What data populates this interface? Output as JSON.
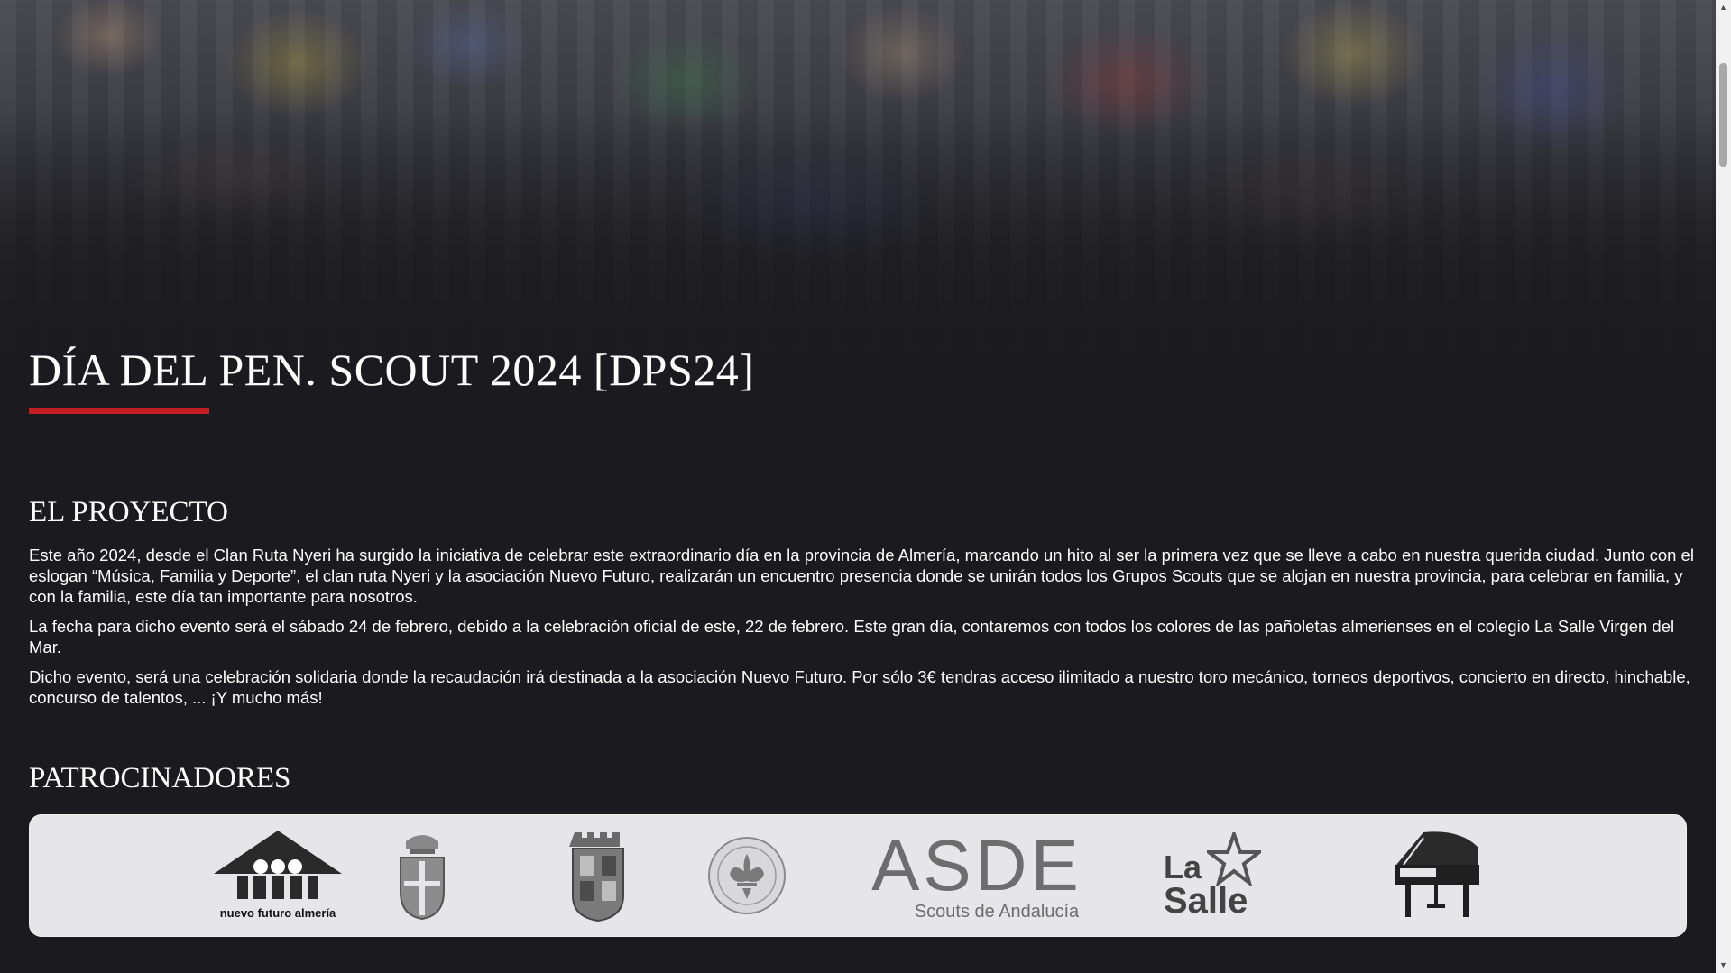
{
  "hero": {
    "image": "scouts-crowd-photo"
  },
  "header": {
    "title": "DÍA DEL PEN. SCOUT 2024 [DPS24]"
  },
  "project": {
    "heading": "EL PROYECTO",
    "paragraphs": [
      "Este año 2024, desde el Clan Ruta Nyeri ha surgido la iniciativa de celebrar este extraordinario día en la provincia de Almería, marcando un hito al ser la primera vez que se lleve a cabo en nuestra querida ciudad. Junto con el eslogan “Música, Familia y Deporte”, el clan ruta Nyeri y la asociación Nuevo Futuro, realizarán un encuentro presencia donde se unirán todos los Grupos Scouts que se alojan en nuestra provincia, para celebrar en familia, y con la familia, este día tan importante para nosotros.",
      "La fecha para dicho evento será el sábado 24 de febrero, debido a la celebración oficial de este, 22 de febrero. Este gran día, contaremos con todos los colores de las pañoletas almerienses en el colegio La Salle Virgen del Mar.",
      "Dicho evento, será una celebración solidaria donde la recaudación irá destinada a la asociación Nuevo Futuro. Por sólo 3€ tendras acceso ilimitado a nuestro toro mecánico, torneos deportivos, concierto en directo, hinchable, concurso de talentos, ... ¡Y mucho más!"
    ]
  },
  "sponsors": {
    "heading": "PATROCINADORES",
    "logos": {
      "nuevo_futuro": {
        "caption": "nuevo futuro almería"
      },
      "crest_1": {},
      "crest_2": {},
      "scout_seal": {},
      "asde": {
        "main": "ASDE",
        "sub": "Scouts de Andalucía"
      },
      "lasalle": {
        "line1": "La",
        "line2": "Salle"
      },
      "piano": {}
    }
  },
  "colors": {
    "accent": "#c41e24",
    "background": "#1b1b1f",
    "sponsor_box": "#e6e6e8"
  }
}
